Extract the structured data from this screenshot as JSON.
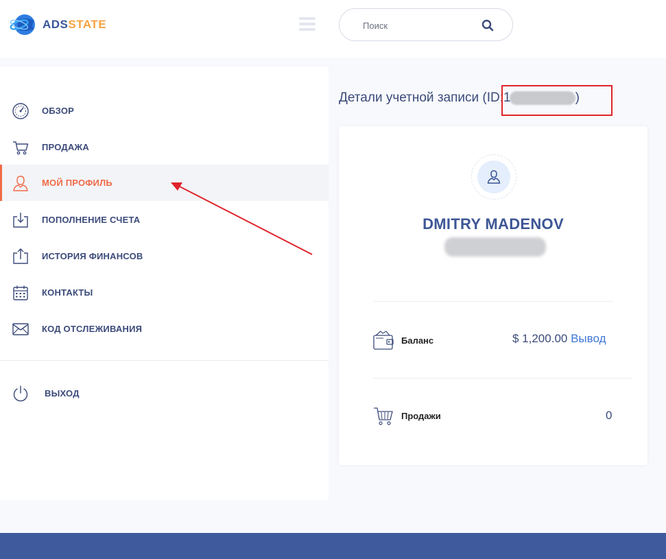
{
  "header": {
    "logo_text_primary": "ADS",
    "logo_text_accent": "STATE",
    "search": {
      "placeholder": "Поиск",
      "value": ""
    }
  },
  "sidebar": {
    "items": [
      {
        "label": "ОБЗОР",
        "icon": "gauge-icon",
        "active": false
      },
      {
        "label": "ПРОДАЖА",
        "icon": "cart-icon",
        "active": false
      },
      {
        "label": "МОЙ ПРОФИЛЬ",
        "icon": "user-icon",
        "active": true
      },
      {
        "label": "ПОПОЛНЕНИЕ СЧЕТА",
        "icon": "download-tray-icon",
        "active": false
      },
      {
        "label": "ИСТОРИЯ ФИНАНСОВ",
        "icon": "upload-tray-icon",
        "active": false
      },
      {
        "label": "КОНТАКТЫ",
        "icon": "calendar-icon",
        "active": false
      },
      {
        "label": "КОД ОТСЛЕЖИВАНИЯ",
        "icon": "envelope-icon",
        "active": false
      }
    ],
    "logout": {
      "label": "ВЫХОД",
      "icon": "power-icon"
    }
  },
  "main": {
    "title": "Детали учетной записи",
    "id_prefix": "(ID:1",
    "id_suffix": ")",
    "profile": {
      "name": "DMITRY MADENOV",
      "balance_label": "Баланс",
      "balance_value": "$ 1,200.00",
      "withdraw_label": "Вывод",
      "sales_label": "Продажи",
      "sales_value": "0"
    }
  },
  "colors": {
    "primary": "#3b4a7a",
    "accent_active": "#f06a48",
    "link": "#3f78d8",
    "annotation_red": "#e0242b",
    "footer": "#405a9e"
  }
}
